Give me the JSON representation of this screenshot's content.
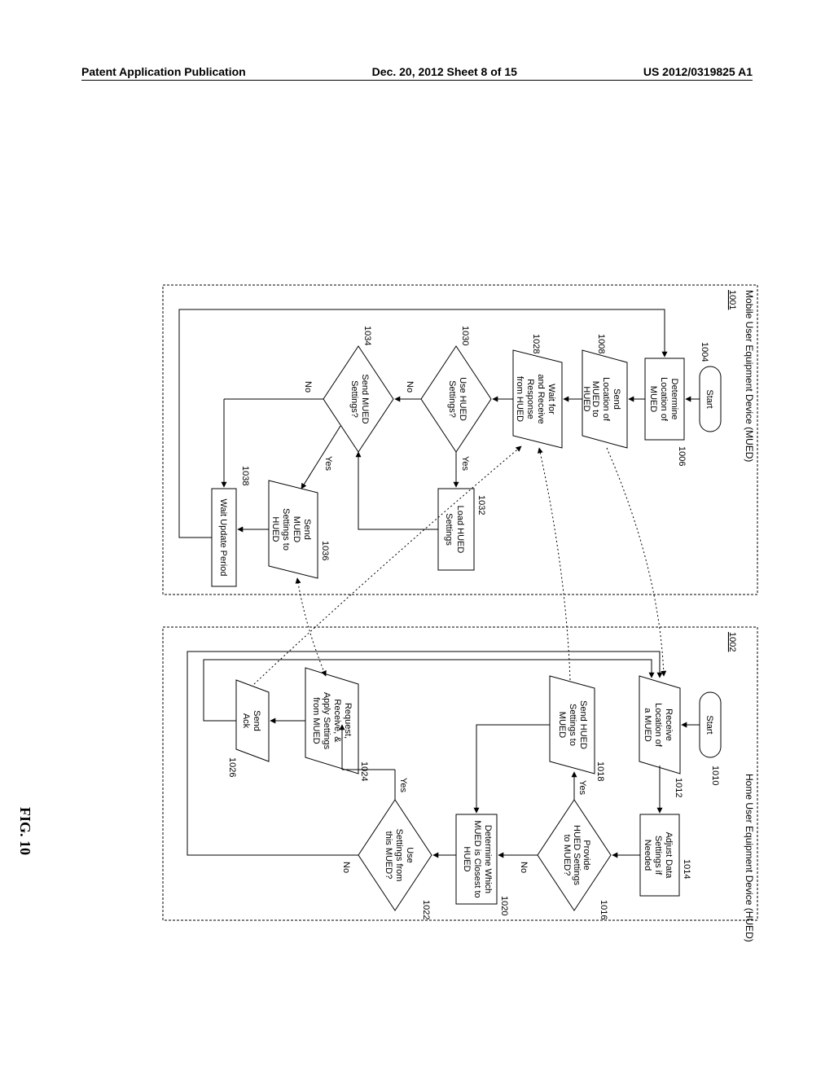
{
  "header": {
    "left": "Patent Application Publication",
    "center": "Dec. 20, 2012  Sheet 8 of 15",
    "right": "US 2012/0319825 A1"
  },
  "figure_label": "FIG. 10",
  "mued": {
    "panel_title": "Mobile User Equipment Device (MUED)",
    "panel_ref": "1001",
    "start": "Start",
    "ref_1004": "1004",
    "determine_loc": "Determine Location of MUED",
    "ref_1006": "1006",
    "send_loc": "Send Location of MUED to HUED",
    "ref_1008": "1008",
    "wait_response": "Wait for and Receive Response from HUED",
    "ref_1028": "1028",
    "use_hued": "Use HUED Settings?",
    "ref_1030": "1030",
    "load_hued": "Load HUED Settings",
    "ref_1032": "1032",
    "send_mued_q": "Send MUED Settings?",
    "ref_1034": "1034",
    "send_mued": "Send MUED Settings to HUED",
    "ref_1036": "1036",
    "wait_period": "Wait Update Period",
    "ref_1038": "1038",
    "yes": "Yes",
    "no": "No"
  },
  "hued": {
    "panel_title": "Home User Equipment Device (HUED)",
    "panel_ref": "1002",
    "start": "Start",
    "ref_1010": "1010",
    "receive_loc": "Receive Location of a MUED",
    "ref_1012": "1012",
    "adjust_data": "Adjust Data Settings if Needed",
    "ref_1014": "1014",
    "provide_q": "Provide HUED Settings to MUED?",
    "ref_1016": "1016",
    "send_settings": "Send HUED Settings to MUED",
    "ref_1018": "1018",
    "determine_closest": "Determine Which MUED is Closest to HUED",
    "ref_1020": "1020",
    "use_settings_q": "Use Settings from this MUED?",
    "ref_1022": "1022",
    "request_apply": "Request, Receive, & Apply Settings from MUED",
    "ref_1024": "1024",
    "send_ack": "Send Ack",
    "ref_1026": "1026",
    "yes": "Yes",
    "no": "No"
  },
  "chart_data": {
    "type": "flowchart",
    "panels": [
      {
        "id": "1001",
        "title": "Mobile User Equipment Device (MUED)",
        "nodes": [
          {
            "id": "1004",
            "type": "terminal",
            "label": "Start"
          },
          {
            "id": "1006",
            "type": "process",
            "label": "Determine Location of MUED"
          },
          {
            "id": "1008",
            "type": "io",
            "label": "Send Location of MUED to HUED"
          },
          {
            "id": "1028",
            "type": "io",
            "label": "Wait for and Receive Response from HUED"
          },
          {
            "id": "1030",
            "type": "decision",
            "label": "Use HUED Settings?"
          },
          {
            "id": "1032",
            "type": "process",
            "label": "Load HUED Settings"
          },
          {
            "id": "1034",
            "type": "decision",
            "label": "Send MUED Settings?"
          },
          {
            "id": "1036",
            "type": "io",
            "label": "Send MUED Settings to HUED"
          },
          {
            "id": "1038",
            "type": "process",
            "label": "Wait Update Period"
          }
        ],
        "edges": [
          {
            "from": "1004",
            "to": "1006"
          },
          {
            "from": "1006",
            "to": "1008"
          },
          {
            "from": "1008",
            "to": "1028"
          },
          {
            "from": "1028",
            "to": "1030"
          },
          {
            "from": "1030",
            "to": "1032",
            "label": "Yes"
          },
          {
            "from": "1030",
            "to": "1034",
            "label": "No"
          },
          {
            "from": "1032",
            "to": "1034"
          },
          {
            "from": "1034",
            "to": "1036",
            "label": "Yes"
          },
          {
            "from": "1034",
            "to": "1038",
            "label": "No"
          },
          {
            "from": "1036",
            "to": "1038"
          },
          {
            "from": "1038",
            "to": "1006",
            "label": "loop"
          }
        ]
      },
      {
        "id": "1002",
        "title": "Home User Equipment Device (HUED)",
        "nodes": [
          {
            "id": "1010",
            "type": "terminal",
            "label": "Start"
          },
          {
            "id": "1012",
            "type": "io",
            "label": "Receive Location of a MUED"
          },
          {
            "id": "1014",
            "type": "process",
            "label": "Adjust Data Settings if Needed"
          },
          {
            "id": "1016",
            "type": "decision",
            "label": "Provide HUED Settings to MUED?"
          },
          {
            "id": "1018",
            "type": "io",
            "label": "Send HUED Settings to MUED"
          },
          {
            "id": "1020",
            "type": "process",
            "label": "Determine Which MUED is Closest to HUED"
          },
          {
            "id": "1022",
            "type": "decision",
            "label": "Use Settings from this MUED?"
          },
          {
            "id": "1024",
            "type": "io",
            "label": "Request, Receive, & Apply Settings from MUED"
          },
          {
            "id": "1026",
            "type": "io",
            "label": "Send Ack"
          }
        ],
        "edges": [
          {
            "from": "1010",
            "to": "1012"
          },
          {
            "from": "1012",
            "to": "1014"
          },
          {
            "from": "1014",
            "to": "1016"
          },
          {
            "from": "1016",
            "to": "1018",
            "label": "Yes"
          },
          {
            "from": "1016",
            "to": "1020",
            "label": "No"
          },
          {
            "from": "1018",
            "to": "1020"
          },
          {
            "from": "1020",
            "to": "1022"
          },
          {
            "from": "1022",
            "to": "1024",
            "label": "Yes"
          },
          {
            "from": "1022",
            "to": "1012",
            "label": "No (loop)"
          },
          {
            "from": "1024",
            "to": "1026"
          },
          {
            "from": "1026",
            "to": "1012",
            "label": "loop"
          }
        ],
        "cross_panel_edges": [
          {
            "from": "1008",
            "to": "1012",
            "style": "dotted"
          },
          {
            "from": "1018",
            "to": "1028",
            "style": "dotted"
          },
          {
            "from": "1024",
            "to": "1036",
            "style": "dotted",
            "bidirectional": true
          },
          {
            "from": "1026",
            "to": "1028",
            "style": "dotted"
          }
        ]
      }
    ]
  }
}
